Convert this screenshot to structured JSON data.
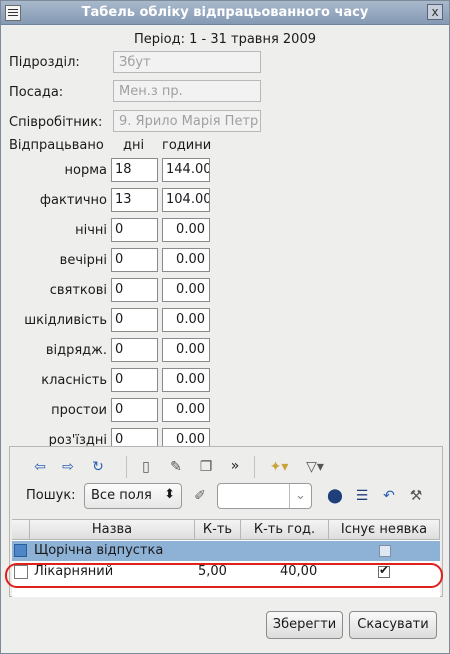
{
  "window": {
    "title": "Табель обліку відпрацьованного часу",
    "close_glyph": "x"
  },
  "period": "Період: 1 - 31 травня 2009",
  "fields": {
    "department_label": "Підрозділ:",
    "department_value": "Збут",
    "position_label": "Посада:",
    "position_value": "Мен.з пр.",
    "employee_label": "Співробітник:",
    "employee_value": "9. Ярило Марія Петр"
  },
  "worked": {
    "heading": "Відпрацьвано",
    "days_header": "дні",
    "hours_header": "години",
    "rows": [
      {
        "label": "норма",
        "days": "18",
        "hours": "144.00"
      },
      {
        "label": "фактично",
        "days": "13",
        "hours": "104.00"
      },
      {
        "label": "нічні",
        "days": "0",
        "hours": "0.00"
      },
      {
        "label": "вечірні",
        "days": "0",
        "hours": "0.00"
      },
      {
        "label": "святкові",
        "days": "0",
        "hours": "0.00"
      },
      {
        "label": "шкідливість",
        "days": "0",
        "hours": "0.00"
      },
      {
        "label": "відрядж.",
        "days": "0",
        "hours": "0.00"
      },
      {
        "label": "класність",
        "days": "0",
        "hours": "0.00"
      },
      {
        "label": "простои",
        "days": "0",
        "hours": "0.00"
      },
      {
        "label": "роз'їздні",
        "days": "0",
        "hours": "0.00"
      }
    ]
  },
  "toolbar": {
    "icons": [
      "arrow-left-icon",
      "arrow-right-icon",
      "refresh-icon",
      "new-document-icon",
      "edit-document-icon",
      "copy-document-icon",
      "more-icon",
      "wand-icon",
      "filter-icon"
    ],
    "search_label": "Пошук:",
    "search_scope": "Все поля",
    "search_value": "",
    "more_glyph": "»"
  },
  "grid": {
    "columns": [
      "Назва",
      "К-ть",
      "К-ть год.",
      "Існує неявка"
    ],
    "rows": [
      {
        "name": "Щорічна відпустка",
        "qty": "",
        "hours": "",
        "absence": false
      },
      {
        "name": "Лікарняний",
        "qty": "5,00",
        "hours": "40,00",
        "absence": true
      }
    ]
  },
  "buttons": {
    "save": "Зберегти",
    "cancel": "Скасувати"
  },
  "colors": {
    "title_bar": "#8ea3bd",
    "selected_row": "#8eb1d6",
    "highlight": "#e0201d"
  }
}
